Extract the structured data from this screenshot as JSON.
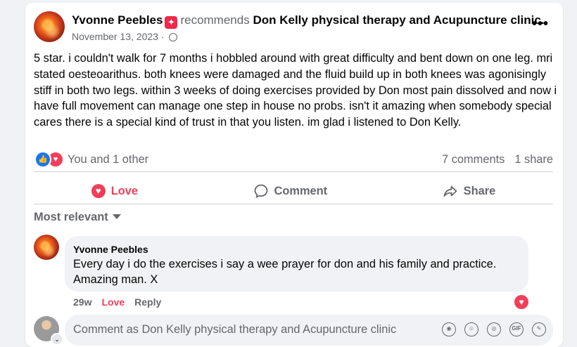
{
  "post": {
    "author": "Yvonne Peebles",
    "recommends_text": "recommends",
    "page_name": "Don Kelly physical therapy and Acupuncture clinic.",
    "date": "November 13, 2023",
    "dot": "·",
    "more_icon": "•••",
    "text": "5 star. i couldn't walk for 7 months i hobbled around with great difficulty and bent down on one leg. mri stated oesteoarithus. both knees were damaged and the fluid build up in both knees was agonisingly stiff in both two legs. within 3 weeks of doing exercises provided by Don most pain dissolved and now i have full movement can manage one step in house no probs. isn't it amazing when somebody special cares there is a special kind of trust in that you listen. im glad i listened to Don Kelly."
  },
  "reactions": {
    "summary": "You and 1 other",
    "icons": [
      "like-icon",
      "love-icon"
    ],
    "comments_count": "7 comments",
    "shares_count": "1 share"
  },
  "actions": {
    "love_label": "Love",
    "comment_label": "Comment",
    "share_label": "Share"
  },
  "sort": {
    "label": "Most relevant"
  },
  "comments": [
    {
      "author": "Yvonne Peebles",
      "text": "Every day i do the exercises i say a wee prayer for don and his family and practice. Amazing man. X",
      "time": "29w",
      "love_label": "Love",
      "reply_label": "Reply"
    }
  ],
  "composer": {
    "placeholder": "Comment as Don Kelly physical therapy and Acupuncture clinic",
    "icons": [
      "avatar-sticker-icon",
      "emoji-icon",
      "camera-icon",
      "gif-icon",
      "sticker-icon"
    ]
  },
  "colors": {
    "love": "#f33e58",
    "like": "#1877f2",
    "secondary_text": "#65676b",
    "background": "#f0f2f5"
  }
}
